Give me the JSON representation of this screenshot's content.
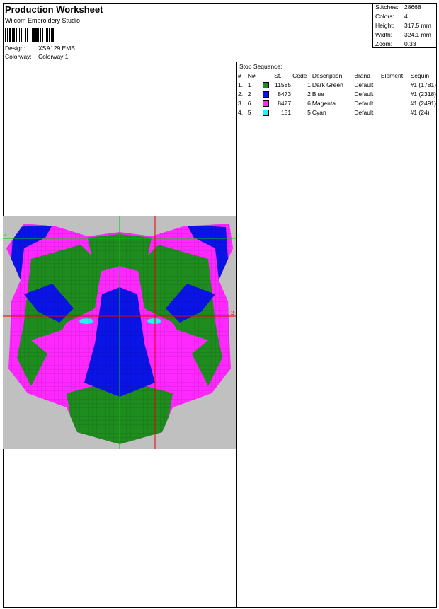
{
  "header": {
    "title": "Production Worksheet",
    "software": "Wilcom Embroidery Studio",
    "design_label": "Design:",
    "design_value": "XSA129.EMB",
    "colorway_label": "Colorway:",
    "colorway_value": "Colorway 1"
  },
  "stats": [
    {
      "label": "Stitches:",
      "value": "28668"
    },
    {
      "label": "Colors:",
      "value": "4"
    },
    {
      "label": "Height:",
      "value": "317.5 mm"
    },
    {
      "label": "Width:",
      "value": "324.1 mm"
    },
    {
      "label": "Zoom:",
      "value": "0.33"
    }
  ],
  "stop_sequence": {
    "title": "Stop Sequence:",
    "columns": [
      "#",
      "N#",
      "St.",
      "Code",
      "Description",
      "Brand",
      "Element",
      "Sequin"
    ],
    "rows": [
      {
        "idx": "1.",
        "n": "1",
        "color": "#1e8c1e",
        "st": "11585",
        "code": "1",
        "desc": "Dark Green",
        "brand": "Default",
        "element": "",
        "sequin": "#1 (1781)"
      },
      {
        "idx": "2.",
        "n": "2",
        "color": "#0a14e6",
        "st": "8473",
        "code": "2",
        "desc": "Blue",
        "brand": "Default",
        "element": "",
        "sequin": "#1 (2318)"
      },
      {
        "idx": "3.",
        "n": "6",
        "color": "#ff28ff",
        "st": "8477",
        "code": "6",
        "desc": "Magenta",
        "brand": "Default",
        "element": "",
        "sequin": "#1 (2491)"
      },
      {
        "idx": "4.",
        "n": "5",
        "color": "#28f0f0",
        "st": "131",
        "code": "5",
        "desc": "Cyan",
        "brand": "Default",
        "element": "",
        "sequin": "#1 (24)"
      }
    ]
  },
  "preview": {
    "background": "#c0c0c0",
    "guide_green": "#00c800",
    "guide_red": "#e60000",
    "marker_1": "1",
    "marker_2": "2"
  }
}
